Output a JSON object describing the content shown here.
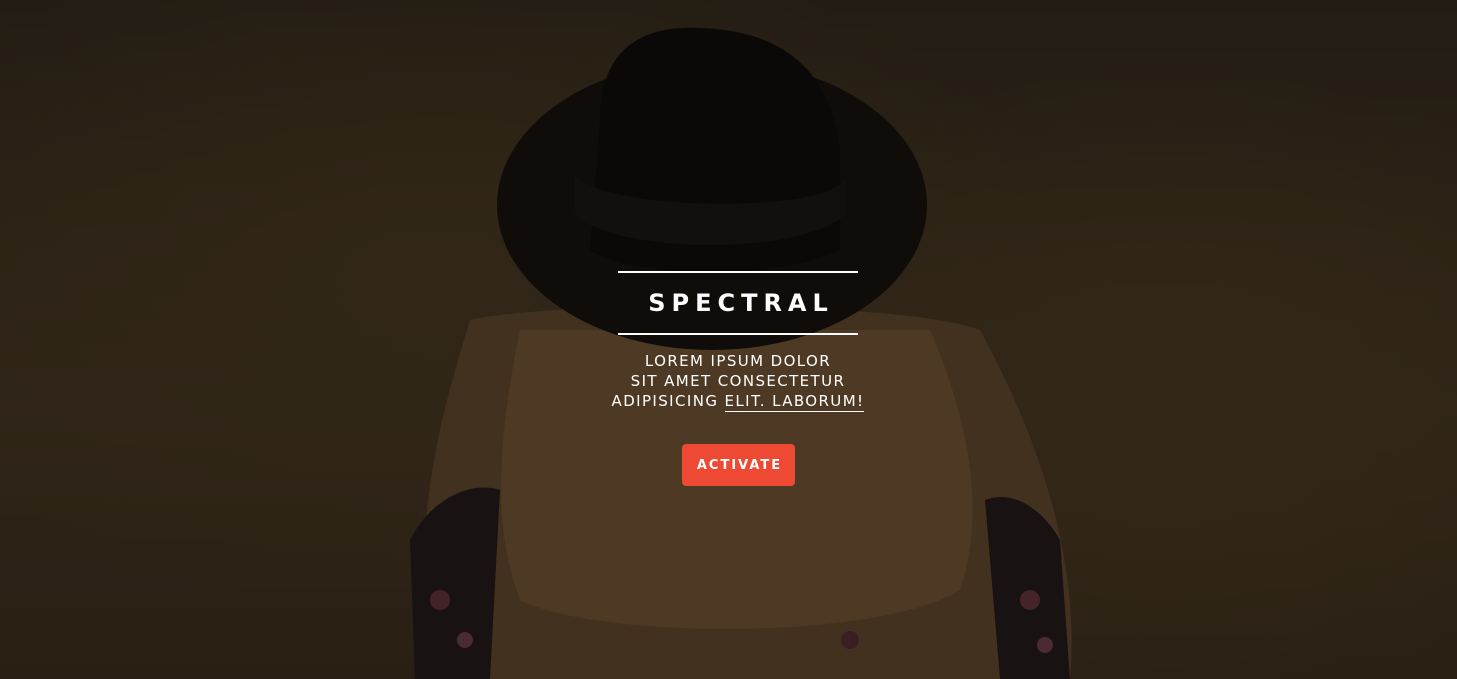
{
  "banner": {
    "title": "SPECTRAL",
    "subtitle_lines": [
      "LOREM IPSUM DOLOR",
      "SIT AMET CONSECTETUR"
    ],
    "subtitle_last_prefix": "ADIPISICING ",
    "subtitle_link": "ELIT. LABORUM!",
    "cta_label": "ACTIVATE"
  },
  "colors": {
    "accent": "#ed4933",
    "text": "#ffffff"
  },
  "background": {
    "image_subject": "woman-in-black-hat-field-photo"
  }
}
